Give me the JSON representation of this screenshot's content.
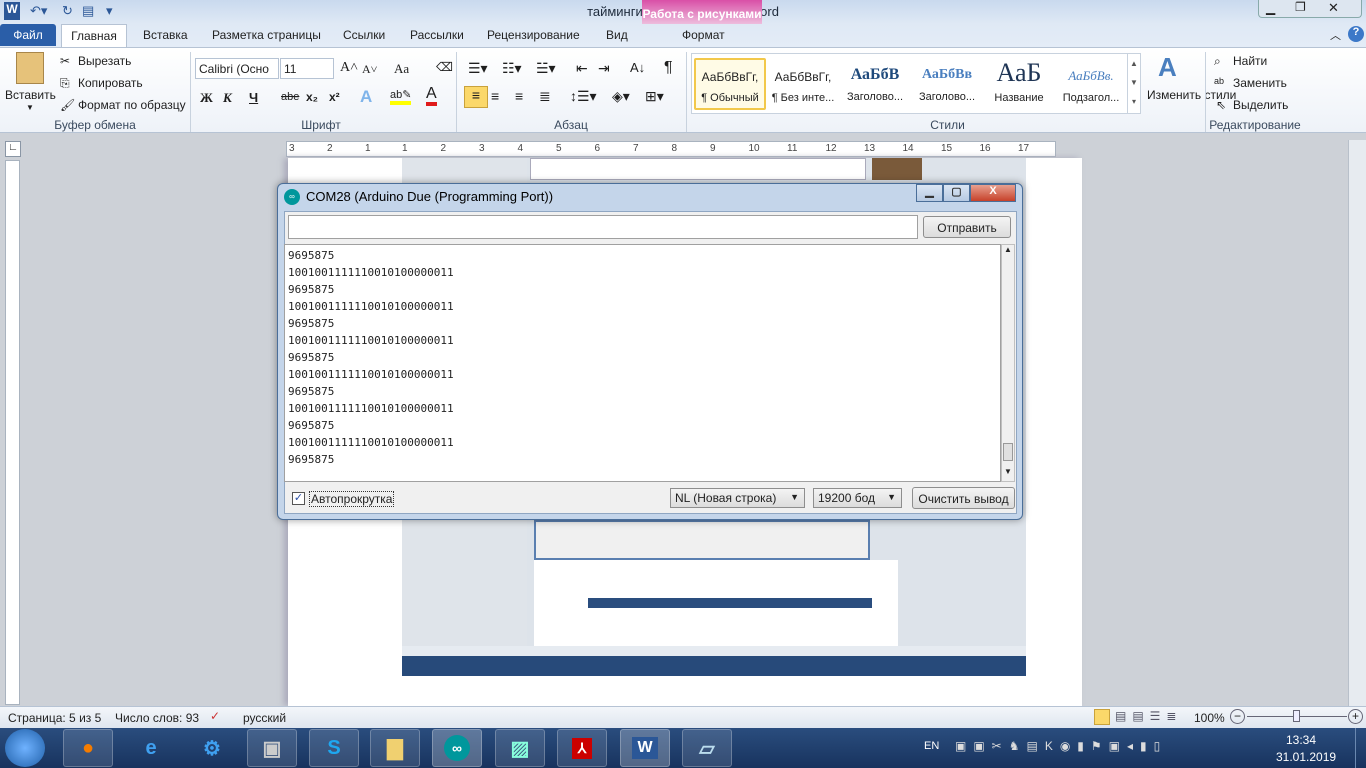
{
  "window": {
    "title": "тайминги скрин  -  Microsoft Word",
    "context_tab_group": "Работа с рисунками",
    "context_tab": "Формат"
  },
  "tabs": [
    "Файл",
    "Главная",
    "Вставка",
    "Разметка страницы",
    "Ссылки",
    "Рассылки",
    "Рецензирование",
    "Вид"
  ],
  "clipboard": {
    "paste": "Вставить",
    "cut": "Вырезать",
    "copy": "Копировать",
    "format_painter": "Формат по образцу",
    "label": "Буфер обмена"
  },
  "font": {
    "name": "Calibri (Осно",
    "size": "11",
    "label": "Шрифт",
    "bold": "Ж",
    "italic": "К",
    "underline": "Ч",
    "strike": "abe",
    "sub": "x₂",
    "sup": "x²",
    "case": "Aa"
  },
  "paragraph": {
    "label": "Абзац"
  },
  "styles": {
    "label": "Стили",
    "items": [
      {
        "preview": "АаБбВвГг,",
        "name": "¶ Обычный"
      },
      {
        "preview": "АаБбВвГг,",
        "name": "¶ Без инте..."
      },
      {
        "preview": "АаБбВ",
        "name": "Заголово..."
      },
      {
        "preview": "АаБбВв",
        "name": "Заголово..."
      },
      {
        "preview": "АаБ",
        "name": "Название"
      },
      {
        "preview": "АаБбВв.",
        "name": "Подзагол..."
      }
    ],
    "change": "Изменить стили"
  },
  "editing": {
    "label": "Редактирование",
    "find": "Найти",
    "replace": "Заменить",
    "select": "Выделить"
  },
  "ruler": [
    "3",
    "2",
    "1",
    "1",
    "2",
    "3",
    "4",
    "5",
    "6",
    "7",
    "8",
    "9",
    "10",
    "11",
    "12",
    "13",
    "14",
    "15",
    "16",
    "17"
  ],
  "serial_monitor": {
    "title": "COM28 (Arduino Due (Programming Port))",
    "input_value": "",
    "send": "Отправить",
    "output_lines": [
      "9695875",
      "1001001111110010100000011",
      "9695875",
      "1001001111110010100000011",
      "9695875",
      "1001001111110010100000011",
      "9695875",
      "1001001111110010100000011",
      "9695875",
      "1001001111110010100000011",
      "9695875",
      "1001001111110010100000011",
      "9695875"
    ],
    "autoscroll": "Автопрокрутка",
    "autoscroll_checked": true,
    "line_ending": "NL (Новая строка)",
    "baud": "19200 бод",
    "clear": "Очистить вывод"
  },
  "statusbar": {
    "page": "Страница: 5 из 5",
    "words": "Число слов: 93",
    "language": "русский",
    "zoom": "100%"
  },
  "taskbar": {
    "lang": "EN",
    "time": "13:34",
    "date": "31.01.2019"
  }
}
